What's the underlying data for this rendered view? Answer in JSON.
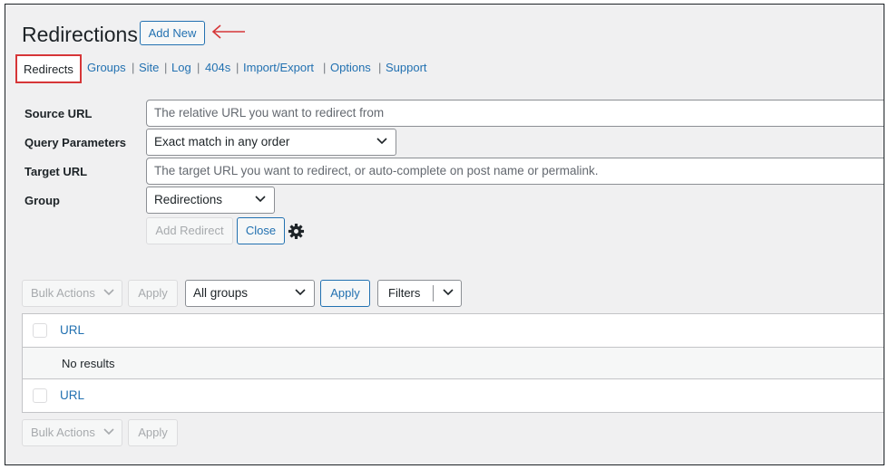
{
  "header": {
    "title": "Redirections",
    "add_new_label": "Add New"
  },
  "subnav": {
    "items": [
      {
        "label": "Redirects",
        "current": true
      },
      {
        "label": "Groups"
      },
      {
        "label": "Site"
      },
      {
        "label": "Log"
      },
      {
        "label": "404s"
      },
      {
        "label": "Import/Export"
      },
      {
        "label": "Options"
      },
      {
        "label": "Support"
      }
    ],
    "separator": "|"
  },
  "form": {
    "source_url": {
      "label": "Source URL",
      "placeholder": "The relative URL you want to redirect from"
    },
    "query_parameters": {
      "label": "Query Parameters",
      "selected": "Exact match in any order"
    },
    "target_url": {
      "label": "Target URL",
      "placeholder": "The target URL you want to redirect, or auto-complete on post name or permalink."
    },
    "group": {
      "label": "Group",
      "selected": "Redirections"
    },
    "add_redirect_label": "Add Redirect",
    "close_label": "Close"
  },
  "toolbar_top": {
    "bulk_actions": "Bulk Actions",
    "apply": "Apply",
    "group_filter": "All groups",
    "apply_filter": "Apply",
    "filters": "Filters"
  },
  "table": {
    "header_column": "URL",
    "empty_message": "No results",
    "footer_column": "URL"
  },
  "toolbar_bottom": {
    "bulk_actions": "Bulk Actions",
    "apply": "Apply"
  },
  "colors": {
    "link": "#2271b1",
    "highlight": "#d63638",
    "text": "#1d2327",
    "background": "#f0f0f1"
  },
  "icons": [
    "left-arrow-icon",
    "chevron-down-icon",
    "gear-icon"
  ]
}
